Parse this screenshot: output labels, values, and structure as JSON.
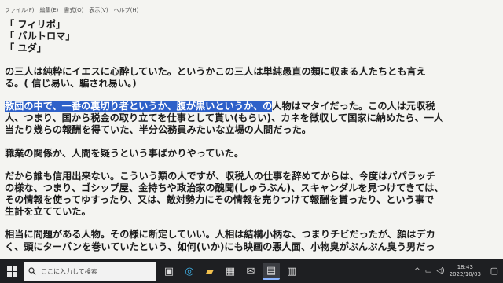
{
  "menu": [
    "ファイル(F)",
    "編集(E)",
    "書式(O)",
    "表示(V)",
    "ヘルプ(H)"
  ],
  "document": {
    "lines_a": [
      "「 フィリポ」",
      "「 バルトロマ」",
      "「 ユダ」"
    ],
    "lines_b": [
      "の三人は純粋にイエスに心酔していた。というかこの三人は単純愚直の類に収まる人たちとも言え",
      "る。(  信じ易い、騙され易い。)"
    ],
    "highlight": "教団の中で、一番の裏切り者というか、腹が黒いというか、の",
    "highlight_rest": "人物はマタイだった。この人は元収税",
    "lines_c": [
      "人、つまり、国から税金の取り立てを仕事として貰い(もらい)、カネを徴収して国家に納めたら、一人",
      "当たり幾らの報酬を得ていた、半分公務員みたいな立場の人間だった。"
    ],
    "lines_d": [
      "職業の関係か、人間を疑うという事ばかりやっていた。"
    ],
    "lines_e": [
      "だから誰も信用出来ない。こういう類の人ですが、収税人の仕事を辞めてからは、今度はパパラッチ",
      "の様な、つまり、ゴシップ屋、金持ちや政治家の醜聞(しゅうぶん)、スキャンダルを見つけてきては、",
      "その情報を使ってゆすったり、又は、敵対勢力にその情報を売りつけて報酬を貰ったり、という事で",
      "生計を立てていた。"
    ],
    "lines_f": [
      "相当に問題がある人物。その様に断定していい。人相は結構小柄な、つまりチビだったが、顔はデカ",
      "く、頭にターバンを巻いていたという、如何(いか)にも映画の悪人面、小物臭がぷんぷん臭う男だっ"
    ]
  },
  "taskbar": {
    "search_placeholder": "ここに入力して検索",
    "clock_time": "18:43",
    "clock_date": "2022/10/03",
    "icons": [
      "task-view-icon",
      "edge-icon",
      "folder-icon",
      "store-icon",
      "mail-icon",
      "notepad-icon",
      "calculator-icon"
    ]
  }
}
